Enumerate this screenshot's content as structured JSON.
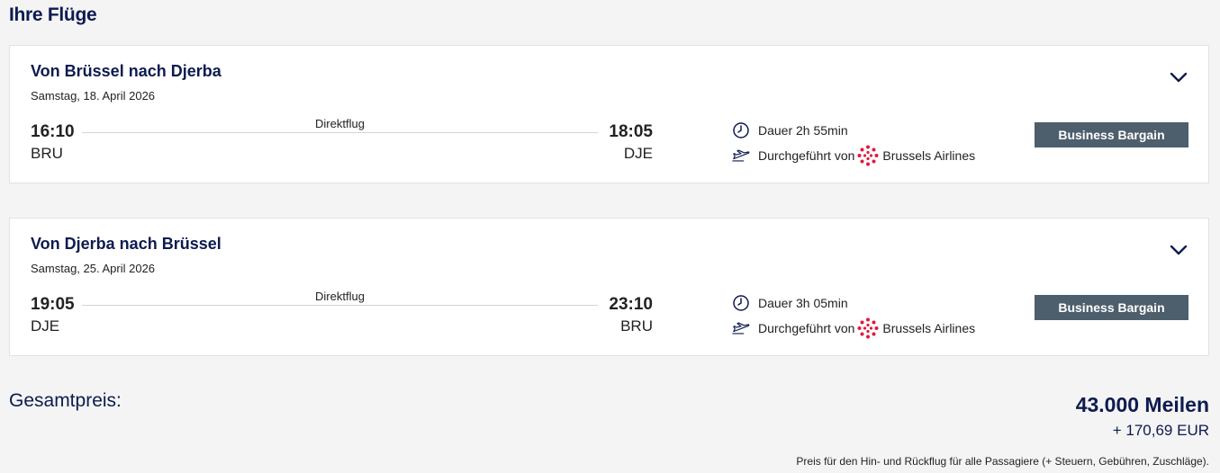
{
  "page": {
    "title": "Ihre Flüge"
  },
  "flights": [
    {
      "title": "Von Brüssel nach Djerba",
      "date": "Samstag, 18. April 2026",
      "departure_time": "16:10",
      "departure_airport": "BRU",
      "arrival_time": "18:05",
      "arrival_airport": "DJE",
      "stops_label": "Direktflug",
      "duration": "Dauer 2h 55min",
      "operated_by_label": "Durchgeführt von",
      "airline": "Brussels Airlines",
      "fare": "Business Bargain"
    },
    {
      "title": "Von Djerba nach Brüssel",
      "date": "Samstag, 25. April 2026",
      "departure_time": "19:05",
      "departure_airport": "DJE",
      "arrival_time": "23:10",
      "arrival_airport": "BRU",
      "stops_label": "Direktflug",
      "duration": "Dauer 3h 05min",
      "operated_by_label": "Durchgeführt von",
      "airline": "Brussels Airlines",
      "fare": "Business Bargain"
    }
  ],
  "total": {
    "label": "Gesamtpreis:",
    "miles": "43.000 Meilen",
    "cash": "+ 170,69 EUR",
    "note": "Preis für den Hin- und Rückflug für alle Passagiere (+ Steuern, Gebühren, Zuschläge)."
  },
  "icons": {
    "chevron": "chevron-down-icon",
    "duration": "clock-icon",
    "operated": "plane-icon",
    "airline_logo": "brussels-airlines-logo"
  },
  "colors": {
    "brand_navy": "#0d1b4f",
    "fare_badge": "#4d5e6c",
    "airline_red": "#e3173e"
  }
}
